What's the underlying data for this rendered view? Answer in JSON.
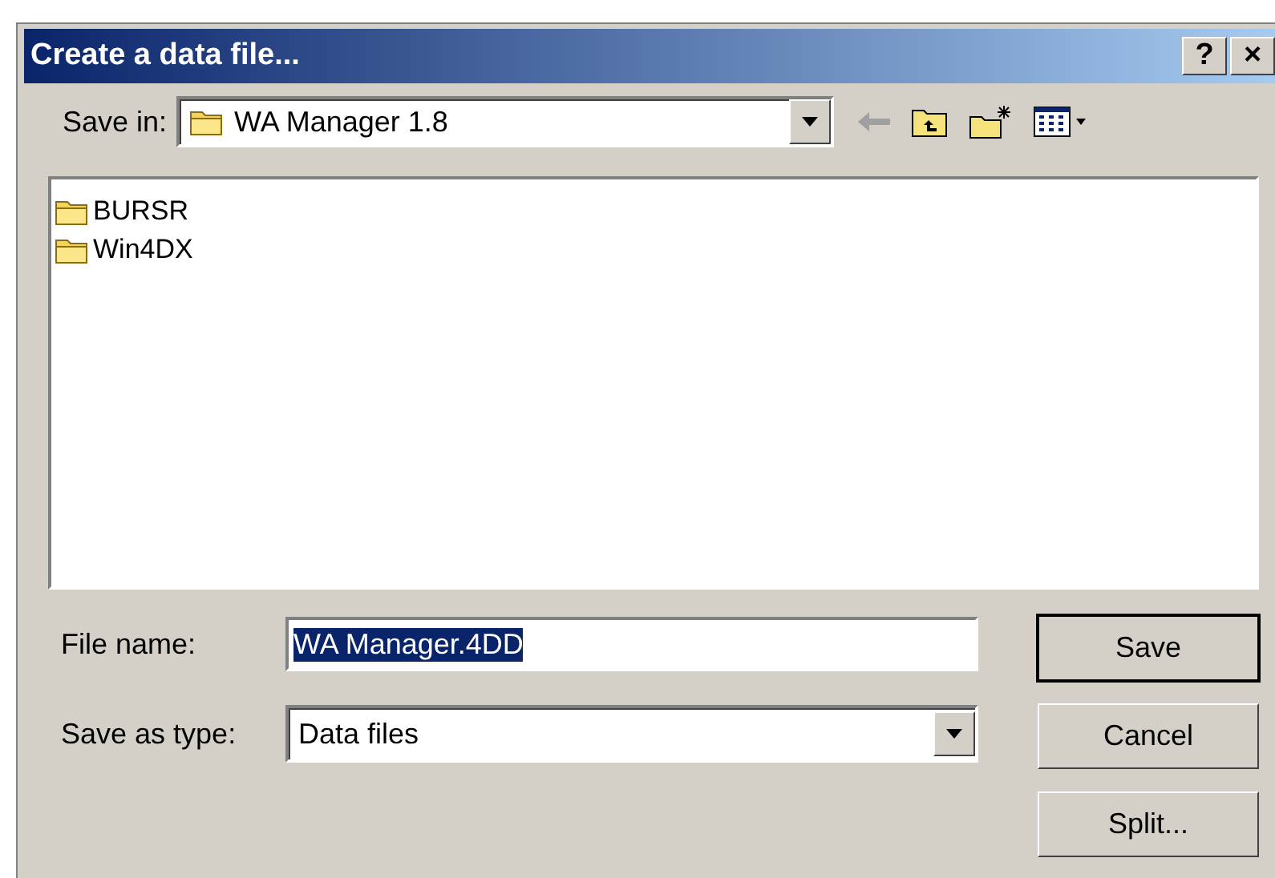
{
  "window": {
    "title": "Create a data file...",
    "title_buttons": [
      "?",
      "×"
    ]
  },
  "save_in": {
    "label": "Save in:",
    "value": "WA Manager 1.8"
  },
  "files": [
    {
      "name": "BURSR"
    },
    {
      "name": "Win4DX"
    }
  ],
  "file_name": {
    "label": "File name:",
    "value": "WA Manager.4DD",
    "text_selected": true
  },
  "save_as_type": {
    "label": "Save as type:",
    "value": "Data files"
  },
  "buttons": [
    {
      "label": "Save",
      "default": true
    },
    {
      "label": "Cancel",
      "default": false
    },
    {
      "label": "Split...",
      "default": false
    }
  ]
}
